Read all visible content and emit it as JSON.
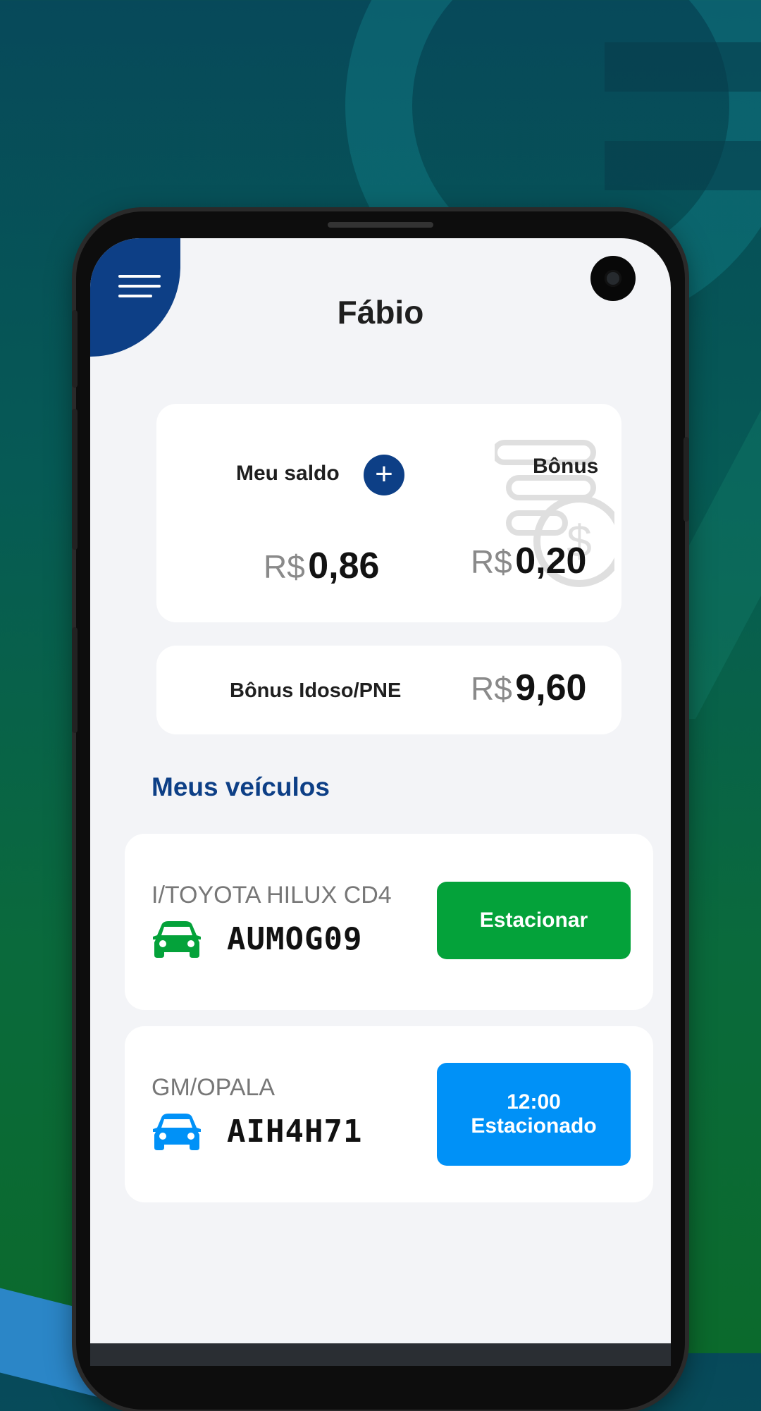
{
  "header": {
    "title": "Fábio"
  },
  "menu": {
    "icon": "menu-icon"
  },
  "balance": {
    "saldo_label": "Meu saldo",
    "saldo_currency": "R$",
    "saldo_value": "0,86",
    "add_icon": "plus-icon",
    "add_glyph": "+",
    "bonus_label": "Bônus",
    "bonus_currency": "R$",
    "bonus_value": "0,20"
  },
  "idoso": {
    "label": "Bônus Idoso/PNE",
    "currency": "R$",
    "value": "9,60"
  },
  "vehicles_section": {
    "title": "Meus veículos"
  },
  "vehicles": [
    {
      "model": "I/TOYOTA HILUX CD4",
      "plate": "AUMOG09",
      "icon": "car-icon",
      "icon_color": "#04a23a",
      "button": {
        "line1": "Estacionar",
        "line2": "",
        "color": "#04a23a"
      }
    },
    {
      "model": "GM/OPALA",
      "plate": "AIH4H71",
      "icon": "car-icon",
      "icon_color": "#0091f7",
      "button": {
        "line1": "12:00",
        "line2": "Estacionado",
        "color": "#0091f7"
      }
    }
  ],
  "colors": {
    "brand_blue": "#0d3f86",
    "green": "#04a23a",
    "light_blue": "#0091f7"
  }
}
